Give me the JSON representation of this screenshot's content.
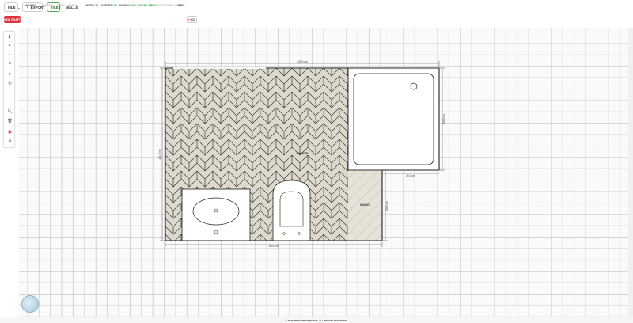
{
  "topbar": {
    "file": "FILE",
    "export": "EXPORT",
    "tiles": "TILES",
    "walls": "WALLS"
  },
  "toolbar": {
    "new_draft": "NEW DRAFT",
    "undo": "UNDO",
    "redo": "REDO",
    "copy": "COPY",
    "paste": "PASTE",
    "units_label": "UNITS",
    "units_value": "CM",
    "guides_label": "GUIDES",
    "guides_value": "ON",
    "snap_label": "SNAP",
    "snap_value": "GUIDE",
    "guide_labels": "GUIDE LABELS",
    "positioning_grout": "POSITIONING GRID",
    "info": "INFO",
    "cm_button": "CM"
  },
  "plan": {
    "dim_top": "240.0 cm",
    "dim_bottom": "190.0 cm",
    "dim_left": "151.0 cm",
    "dim_right_upper": "90.0 cm",
    "dim_right_lower": "60.0 cm",
    "dim_middle": "30.0 cm",
    "shower": "SHOWER",
    "mixing": "MIXING",
    "colors": {
      "tile_fill": "#ddd9cd",
      "tile_line": "#3a3a3a",
      "wall": "#222222"
    }
  },
  "footer": {
    "copyright": "© 2020 TRUESPIROSQUARE. ALL RIGHTS RESERVED."
  },
  "icons": [
    "info-icon",
    "dot-icon",
    "minus-icon",
    "rotate-icon",
    "pencil-icon",
    "layers-icon",
    "circle-icon",
    "target-icon",
    "zoom-icon",
    "trash-icon",
    "red-badge-icon",
    "gear-icon",
    "compass-icon"
  ]
}
